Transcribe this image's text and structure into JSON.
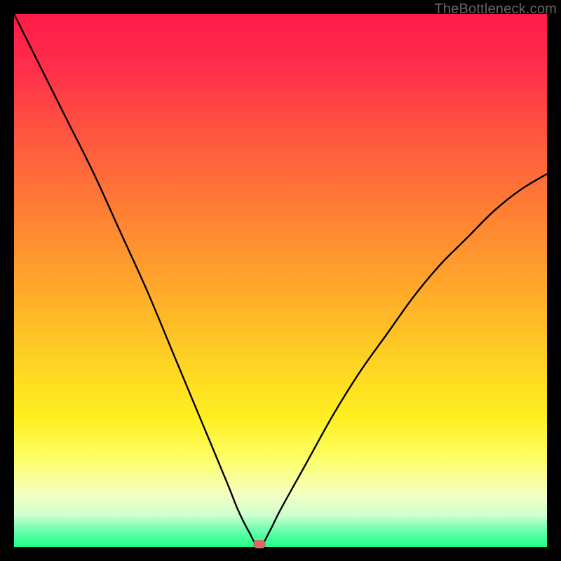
{
  "watermark": "TheBottleneck.com",
  "chart_data": {
    "type": "line",
    "title": "",
    "xlabel": "",
    "ylabel": "",
    "xlim": [
      0,
      100
    ],
    "ylim": [
      0,
      100
    ],
    "grid": false,
    "series": [
      {
        "name": "bottleneck-curve",
        "x": [
          0,
          5,
          10,
          15,
          20,
          25,
          30,
          35,
          40,
          42,
          44,
          46,
          48,
          50,
          55,
          60,
          65,
          70,
          75,
          80,
          85,
          90,
          95,
          100
        ],
        "values": [
          100,
          90,
          80,
          70,
          59,
          48,
          36,
          24,
          12,
          7,
          3,
          0,
          3,
          7,
          16,
          25,
          33,
          40,
          47,
          53,
          58,
          63,
          67,
          70
        ]
      }
    ],
    "optimum_point": {
      "x": 46,
      "y": 0
    },
    "gradient_stops": [
      {
        "pos": 0.0,
        "color": "#ff1a48"
      },
      {
        "pos": 0.25,
        "color": "#ff6a3a"
      },
      {
        "pos": 0.55,
        "color": "#ffc225"
      },
      {
        "pos": 0.78,
        "color": "#fff420"
      },
      {
        "pos": 0.92,
        "color": "#e8ffc8"
      },
      {
        "pos": 1.0,
        "color": "#1fff88"
      }
    ]
  }
}
